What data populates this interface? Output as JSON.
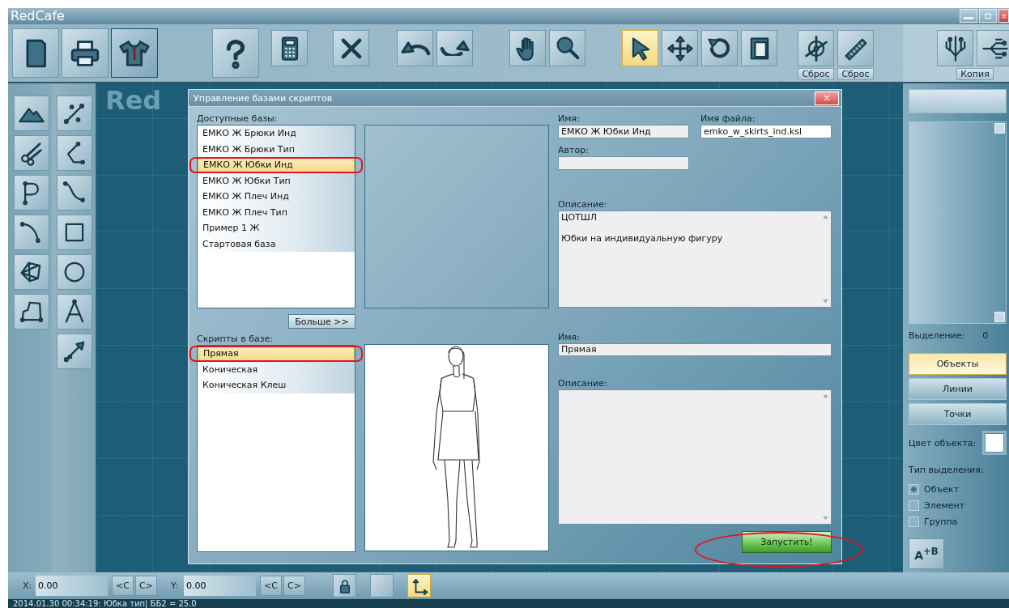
{
  "window": {
    "title": "RedCafe"
  },
  "toolbar": {
    "groups": [
      {
        "buttons": [
          {
            "kind": "large",
            "selected": false
          },
          {
            "kind": "large",
            "selected": false
          },
          {
            "kind": "large",
            "selected": true
          }
        ]
      },
      {
        "buttons": [
          {
            "kind": "large",
            "selected": false
          }
        ]
      },
      {
        "buttons": [
          {
            "kind": "small",
            "selected": false
          }
        ]
      },
      {
        "buttons": [
          {
            "kind": "small",
            "selected": false
          }
        ]
      },
      {
        "buttons": [
          {
            "kind": "small",
            "selected": false
          },
          {
            "kind": "small",
            "selected": false
          }
        ]
      },
      {
        "buttons": [
          {
            "kind": "small",
            "selected": false
          },
          {
            "kind": "small",
            "selected": false
          }
        ]
      },
      {
        "buttons": [
          {
            "kind": "small",
            "selected": true
          },
          {
            "kind": "small",
            "selected": false
          },
          {
            "kind": "small",
            "selected": false
          },
          {
            "kind": "small",
            "selected": false
          }
        ]
      },
      {
        "buttons": [
          {
            "kind": "small",
            "selected": false,
            "caption": "Сброс"
          },
          {
            "kind": "small",
            "selected": false,
            "caption": "Сброс"
          }
        ]
      },
      {
        "buttons": [
          {
            "kind": "small",
            "selected": false
          },
          {
            "kind": "small",
            "selected": false
          }
        ],
        "caption": "Копия"
      }
    ]
  },
  "tools": {
    "columns": [
      [
        {
          "selected": false
        },
        {
          "selected": false
        },
        {
          "selected": false
        },
        {
          "selected": false
        },
        {
          "selected": false
        },
        {
          "selected": false
        }
      ],
      [
        {
          "selected": false
        },
        {
          "selected": false
        },
        {
          "selected": false
        },
        {
          "selected": false
        },
        {
          "selected": false
        },
        {
          "selected": false
        },
        {
          "selected": false
        }
      ]
    ]
  },
  "canvas": {
    "logo": "Red"
  },
  "dialog": {
    "title": "Управление базами скриптов",
    "bases": {
      "label": "Доступные базы:",
      "items": [
        {
          "label": "ЕМКО Ж Брюки Инд",
          "selected": false,
          "circled": false
        },
        {
          "label": "ЕМКО Ж Брюки Тип",
          "selected": false,
          "circled": false
        },
        {
          "label": "ЕМКО Ж Юбки Инд",
          "selected": true,
          "circled": true
        },
        {
          "label": "ЕМКО Ж Юбки Тип",
          "selected": false,
          "circled": false
        },
        {
          "label": "ЕМКО Ж Плеч Инд",
          "selected": false,
          "circled": false
        },
        {
          "label": "ЕМКО Ж Плеч Тип",
          "selected": false,
          "circled": false
        },
        {
          "label": "Пример 1 Ж",
          "selected": false,
          "circled": false
        },
        {
          "label": "Стартовая база",
          "selected": false,
          "circled": false
        }
      ]
    },
    "more_button": "Больше >>",
    "base_name": {
      "label": "Имя:",
      "value": "ЕМКО Ж Юбки Инд"
    },
    "file_name": {
      "label": "Имя файла:",
      "value": "emko_w_skirts_ind.ksl"
    },
    "author": {
      "label": "Автор:"
    },
    "base_description": {
      "label": "Описание:",
      "value": "ЦОТШЛ\n\nЮбки на индивидуальную фигуру"
    },
    "scripts": {
      "label": "Скрипты в базе:",
      "items": [
        {
          "label": "Прямая",
          "selected": true,
          "circled": true
        },
        {
          "label": "Коническая",
          "selected": false,
          "circled": false
        },
        {
          "label": "Коническая Клеш",
          "selected": false,
          "circled": false
        }
      ]
    },
    "script_name": {
      "label": "Имя:",
      "value": "Прямая"
    },
    "script_description": {
      "label": "Описание:"
    },
    "run_button": {
      "label": "Запустить!",
      "circled": true
    }
  },
  "right_panel": {
    "selection_label": "Выделение:",
    "selection_count": "0",
    "modes": [
      {
        "label": "Объекты",
        "selected": true
      },
      {
        "label": "Линии",
        "selected": false
      },
      {
        "label": "Точки",
        "selected": false
      }
    ],
    "color_label": "Цвет объекта:",
    "selection_type": {
      "label": "Тип выделения:",
      "options": [
        {
          "label": "Объект",
          "checked": true
        },
        {
          "label": "Элемент",
          "checked": false
        },
        {
          "label": "Группа",
          "checked": false
        }
      ]
    },
    "ab_button": "A$^{+B}$"
  },
  "bottom_bar": {
    "axes": [
      {
        "label": "X:",
        "value": "0.00",
        "buttons": [
          "<C",
          "C>"
        ]
      },
      {
        "label": "Y:",
        "value": "0.00",
        "buttons": [
          "<C",
          "C>"
        ]
      }
    ],
    "tools": [
      {
        "selected": false
      },
      {
        "selected": false
      },
      {
        "selected": true
      }
    ]
  },
  "status_bar": "2014.01.30 00:34:19: Юбка тип| ББ2 = 25.0"
}
